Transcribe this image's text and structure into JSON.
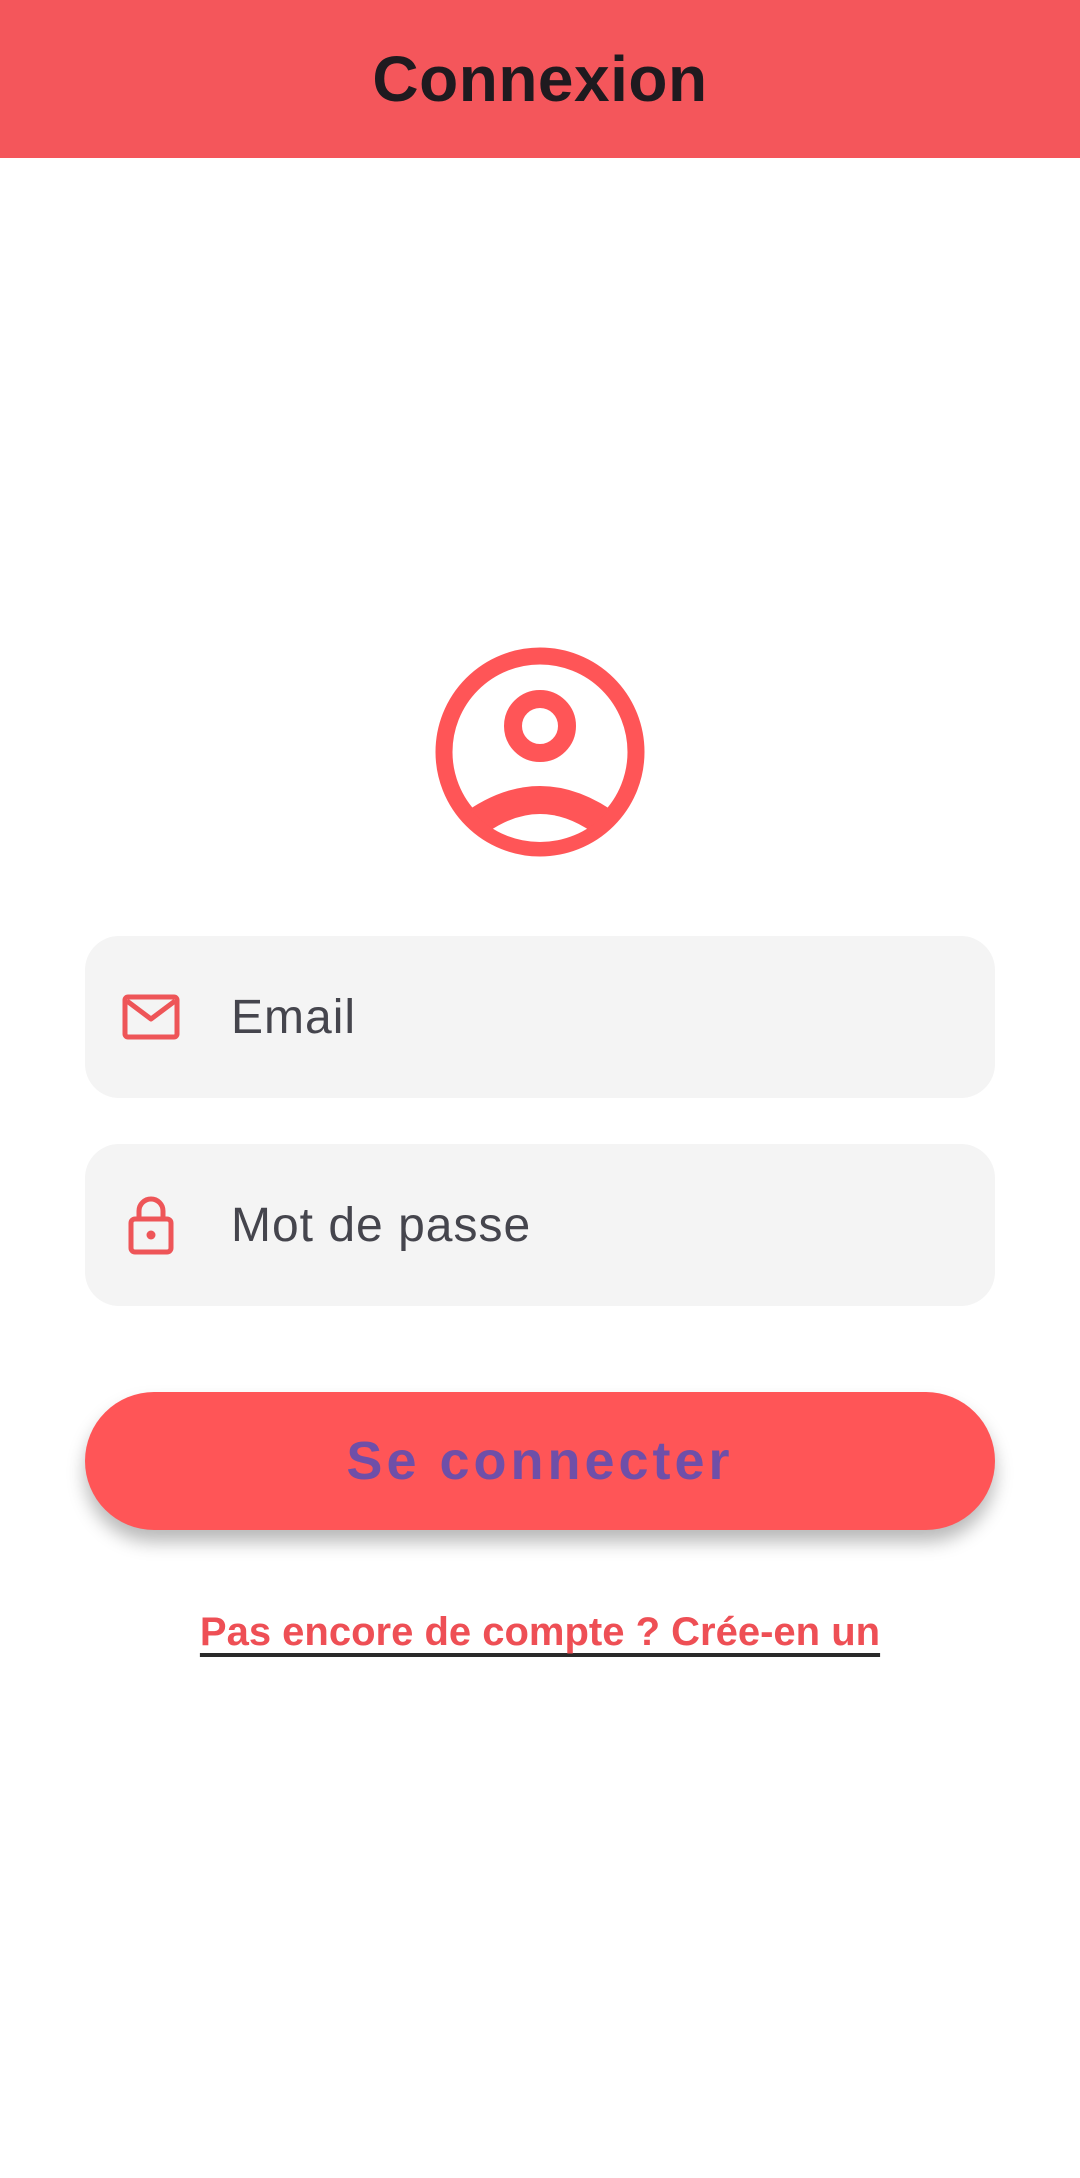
{
  "header": {
    "title": "Connexion",
    "background_color": "#F4565B"
  },
  "avatar": {
    "icon": "account-circle-icon",
    "color": "#FF5557"
  },
  "form": {
    "email": {
      "icon": "mail-icon",
      "placeholder": "Email",
      "value": ""
    },
    "password": {
      "icon": "lock-icon",
      "placeholder": "Mot de passe",
      "value": ""
    },
    "submit_label": "Se connecter",
    "submit_color": "#FF5557",
    "submit_text_color": "#6F4FA8"
  },
  "signup_link": {
    "label": "Pas encore de compte ? Crée-en un",
    "color": "#EE4F55"
  }
}
